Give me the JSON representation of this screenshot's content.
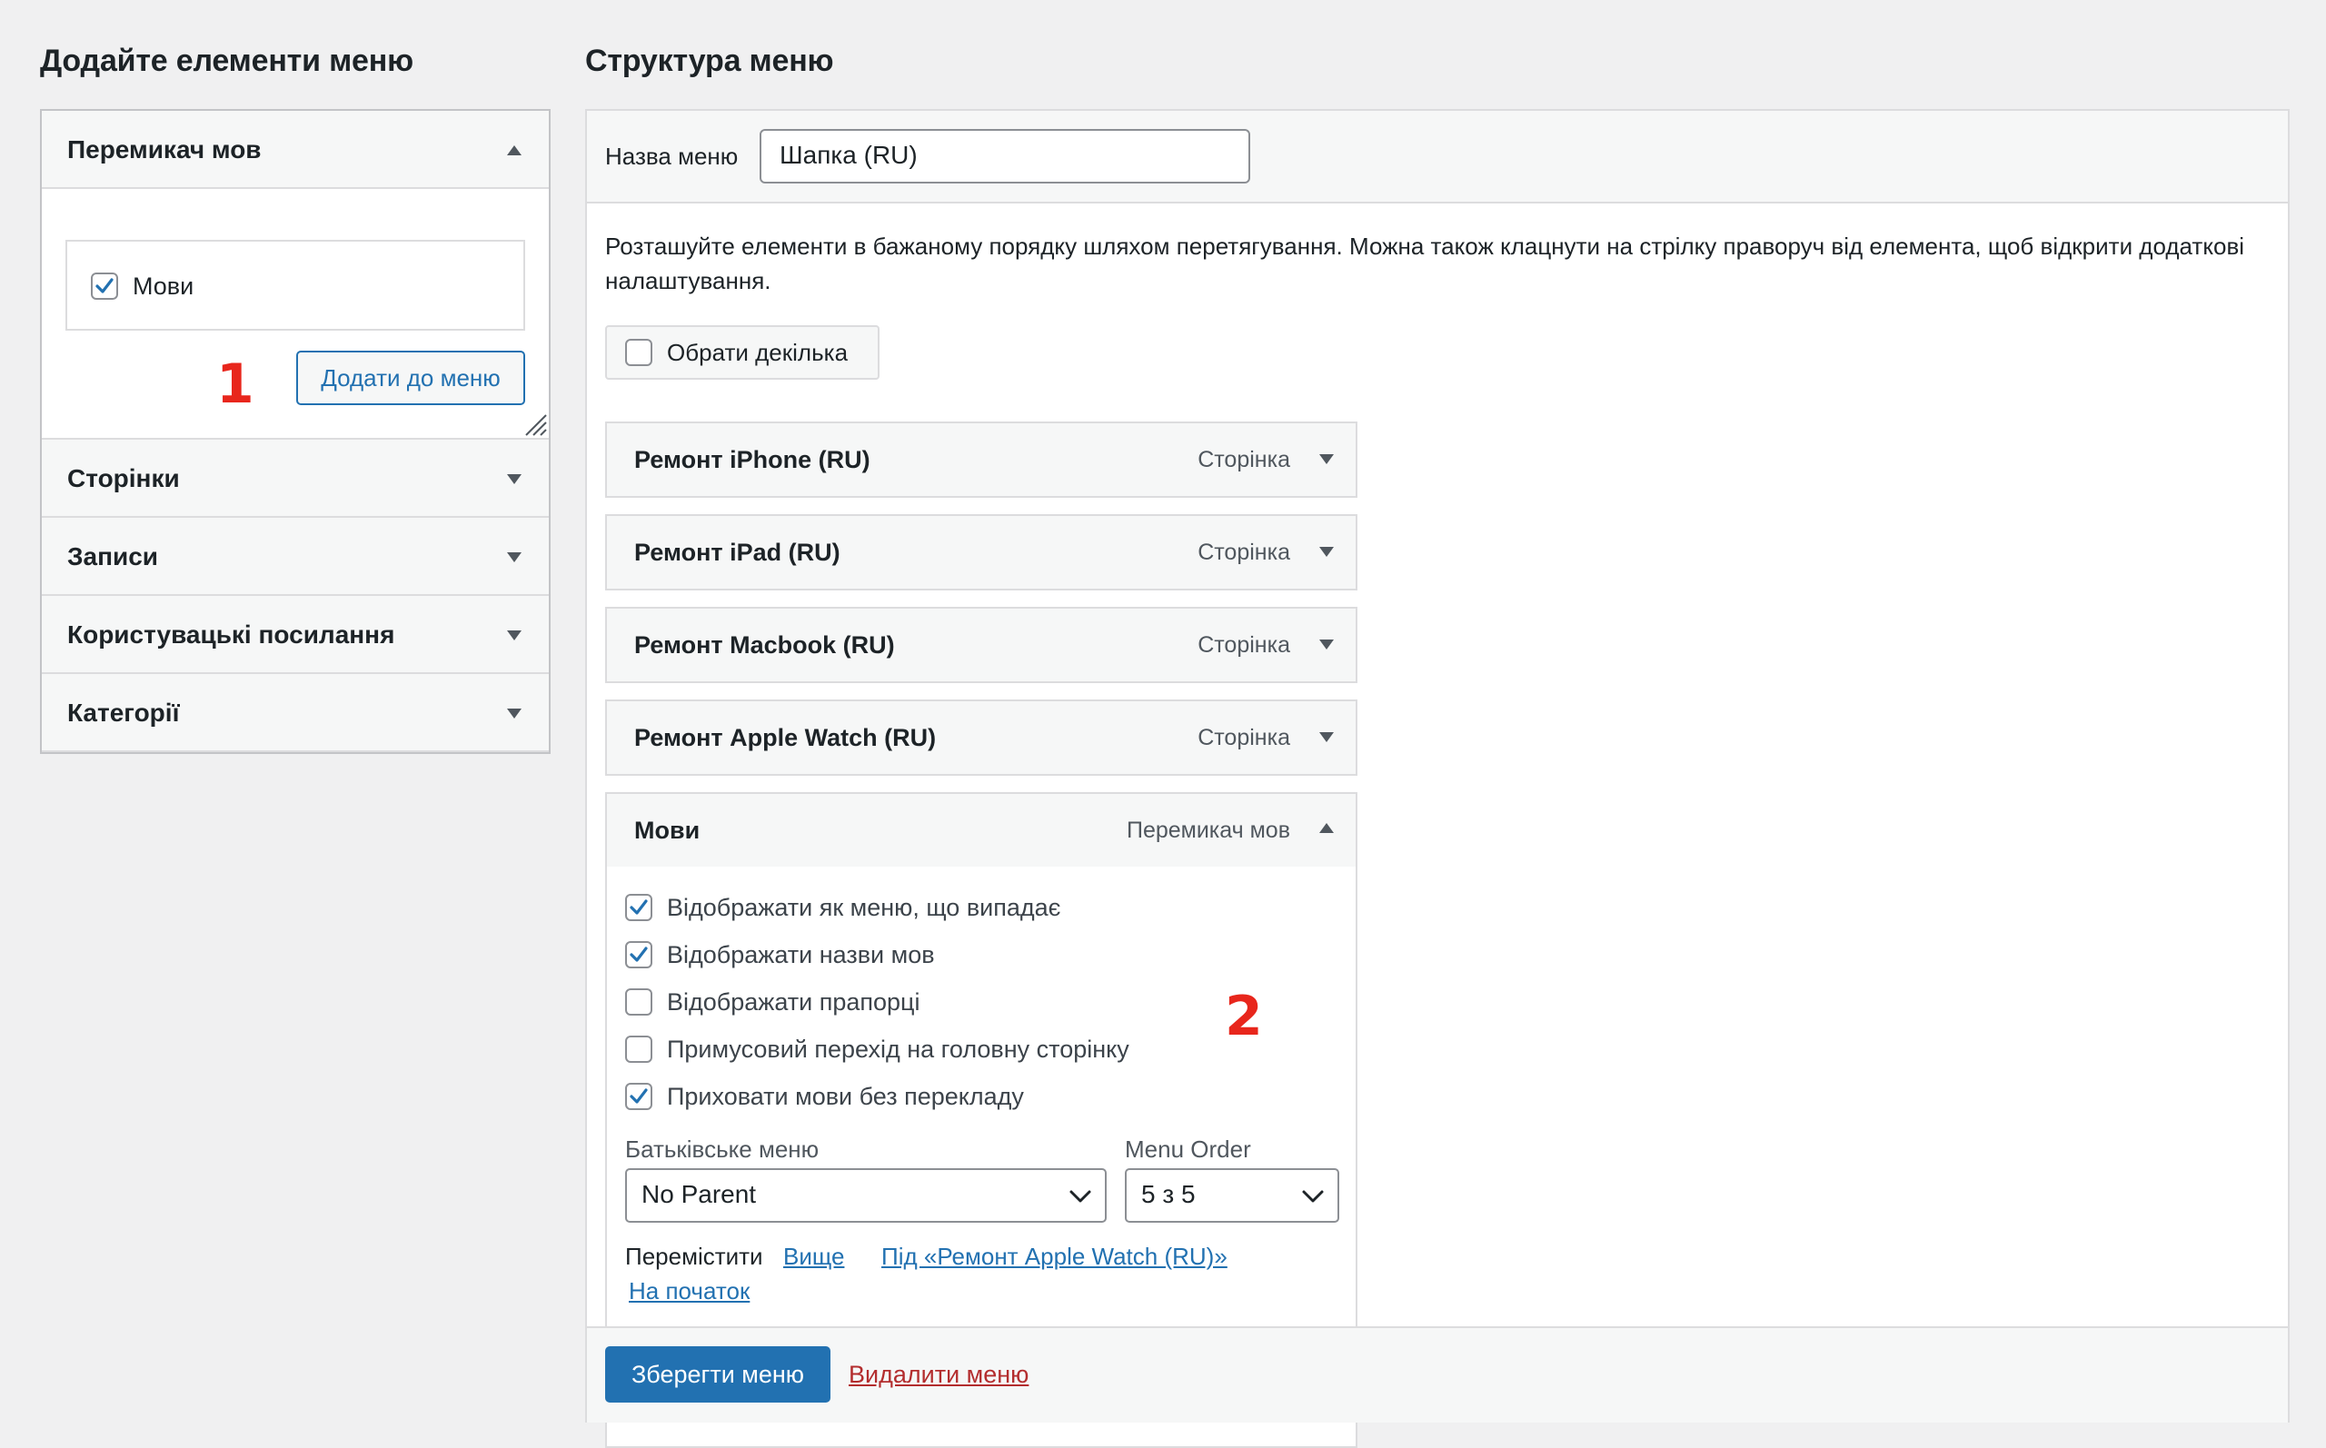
{
  "left": {
    "heading": "Додайте елементи меню",
    "language_switcher": {
      "title": "Перемикач мов",
      "item_label": "Мови",
      "item_checked": true,
      "add_button": "Додати до меню"
    },
    "sections": [
      {
        "title": "Сторінки"
      },
      {
        "title": "Записи"
      },
      {
        "title": "Користувацькі посилання"
      },
      {
        "title": "Категорії"
      }
    ],
    "annotation": "1"
  },
  "right": {
    "heading": "Структура меню",
    "menu_name_label": "Назва меню",
    "menu_name_value": "Шапка (RU)",
    "description": "Розташуйте елементи в бажаному порядку шляхом перетягування. Можна також клацнути на стрілку праворуч від елемента, щоб відкрити додаткові налаштування.",
    "bulk_select_label": "Обрати декілька",
    "items": [
      {
        "title": "Ремонт iPhone (RU)",
        "type": "Сторінка"
      },
      {
        "title": "Ремонт iPad (RU)",
        "type": "Сторінка"
      },
      {
        "title": "Ремонт Macbook (RU)",
        "type": "Сторінка"
      },
      {
        "title": "Ремонт Apple Watch (RU)",
        "type": "Сторінка"
      },
      {
        "title": "Мови",
        "type": "Перемикач мов"
      }
    ],
    "options": [
      {
        "label": "Відображати як меню, що випадає",
        "checked": true
      },
      {
        "label": "Відображати назви мов",
        "checked": true
      },
      {
        "label": "Відображати прапорці",
        "checked": false
      },
      {
        "label": "Примусовий перехід на головну сторінку",
        "checked": false
      },
      {
        "label": "Приховати мови без перекладу",
        "checked": true
      }
    ],
    "parent_label": "Батьківське меню",
    "parent_value": "No Parent",
    "order_label": "Menu Order",
    "order_value": "5 з 5",
    "move_label": "Перемістити",
    "move_links": [
      "Вище",
      "Під «Ремонт Apple Watch (RU)»",
      "На початок"
    ],
    "save_button": "Зберегти меню",
    "delete_link": "Видалити меню",
    "annotation": "2"
  },
  "colors": {
    "accent": "#2271b1",
    "danger": "#b32d2e",
    "annotation": "#e8261c",
    "background": "#f0f0f1"
  }
}
